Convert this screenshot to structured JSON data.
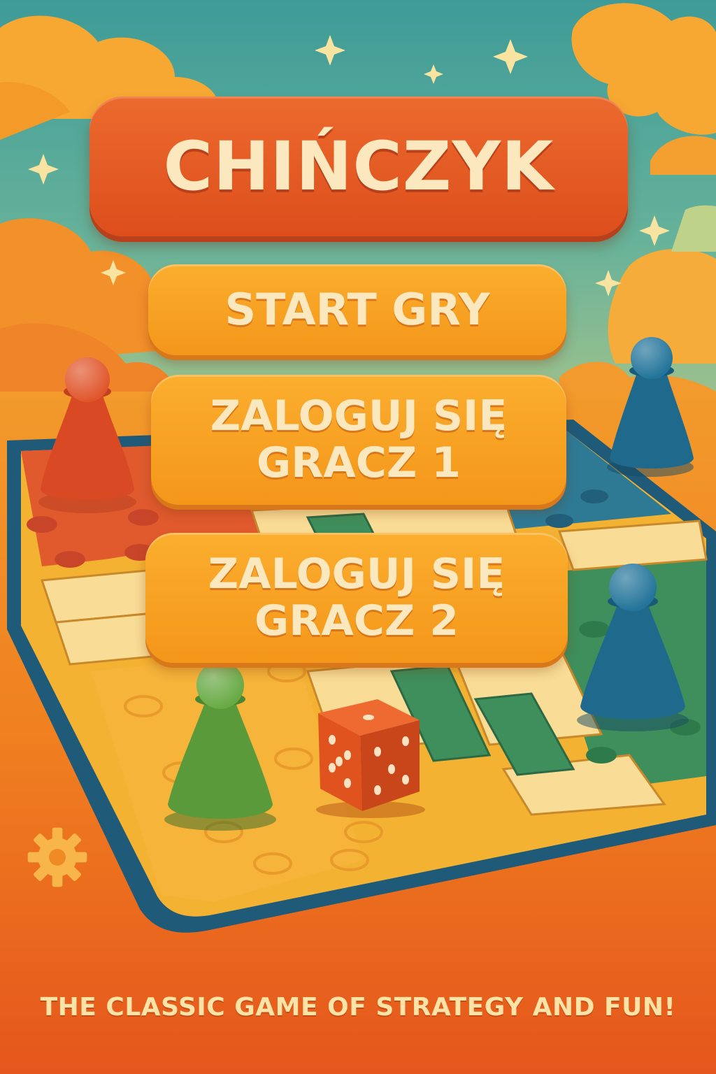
{
  "title": "CHIŃCZYK",
  "menu": {
    "start_label": "START GRY",
    "player1_label": "ZALOGUJ SIĘ\nGRACZ 1",
    "player2_label": "ZALOGUJ SIĘ\nGRACZ 2"
  },
  "tagline": "THE CLASSIC GAME OF STRATEGY AND FUN!",
  "icons": {
    "settings": "gear-icon"
  },
  "colors": {
    "title_bg": "#e4582a",
    "button_bg": "#f7a324",
    "text_cream": "#fbe8be",
    "sky": "#4aa69a",
    "board_border": "#1f5a78",
    "red_pawn": "#d94a24",
    "blue_pawn": "#1f6a8c",
    "green_pawn": "#5a9a3a",
    "die": "#e0531f"
  }
}
